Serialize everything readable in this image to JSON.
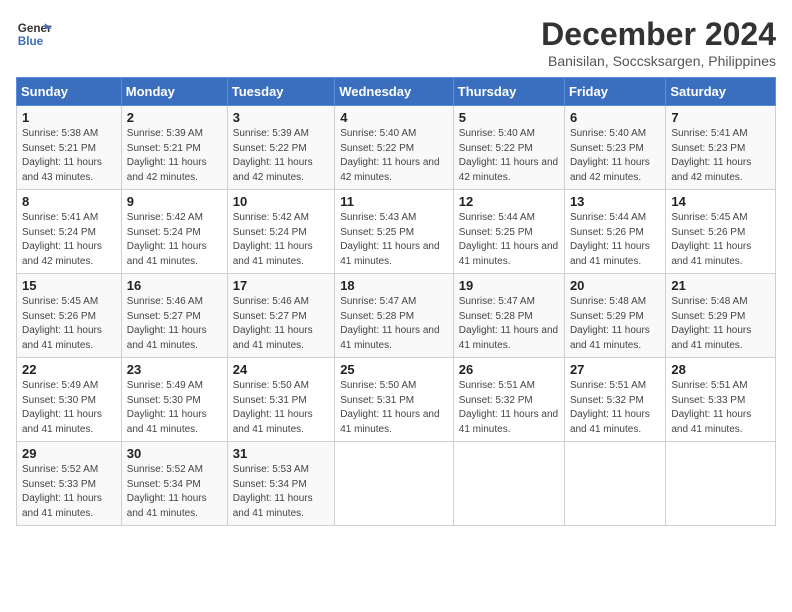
{
  "header": {
    "logo_line1": "General",
    "logo_line2": "Blue",
    "month": "December 2024",
    "location": "Banisilan, Soccsksargen, Philippines"
  },
  "days_of_week": [
    "Sunday",
    "Monday",
    "Tuesday",
    "Wednesday",
    "Thursday",
    "Friday",
    "Saturday"
  ],
  "weeks": [
    [
      {
        "day": 1,
        "sunrise": "5:38 AM",
        "sunset": "5:21 PM",
        "daylight": "11 hours and 43 minutes."
      },
      {
        "day": 2,
        "sunrise": "5:39 AM",
        "sunset": "5:21 PM",
        "daylight": "11 hours and 42 minutes."
      },
      {
        "day": 3,
        "sunrise": "5:39 AM",
        "sunset": "5:22 PM",
        "daylight": "11 hours and 42 minutes."
      },
      {
        "day": 4,
        "sunrise": "5:40 AM",
        "sunset": "5:22 PM",
        "daylight": "11 hours and 42 minutes."
      },
      {
        "day": 5,
        "sunrise": "5:40 AM",
        "sunset": "5:22 PM",
        "daylight": "11 hours and 42 minutes."
      },
      {
        "day": 6,
        "sunrise": "5:40 AM",
        "sunset": "5:23 PM",
        "daylight": "11 hours and 42 minutes."
      },
      {
        "day": 7,
        "sunrise": "5:41 AM",
        "sunset": "5:23 PM",
        "daylight": "11 hours and 42 minutes."
      }
    ],
    [
      {
        "day": 8,
        "sunrise": "5:41 AM",
        "sunset": "5:24 PM",
        "daylight": "11 hours and 42 minutes."
      },
      {
        "day": 9,
        "sunrise": "5:42 AM",
        "sunset": "5:24 PM",
        "daylight": "11 hours and 41 minutes."
      },
      {
        "day": 10,
        "sunrise": "5:42 AM",
        "sunset": "5:24 PM",
        "daylight": "11 hours and 41 minutes."
      },
      {
        "day": 11,
        "sunrise": "5:43 AM",
        "sunset": "5:25 PM",
        "daylight": "11 hours and 41 minutes."
      },
      {
        "day": 12,
        "sunrise": "5:44 AM",
        "sunset": "5:25 PM",
        "daylight": "11 hours and 41 minutes."
      },
      {
        "day": 13,
        "sunrise": "5:44 AM",
        "sunset": "5:26 PM",
        "daylight": "11 hours and 41 minutes."
      },
      {
        "day": 14,
        "sunrise": "5:45 AM",
        "sunset": "5:26 PM",
        "daylight": "11 hours and 41 minutes."
      }
    ],
    [
      {
        "day": 15,
        "sunrise": "5:45 AM",
        "sunset": "5:26 PM",
        "daylight": "11 hours and 41 minutes."
      },
      {
        "day": 16,
        "sunrise": "5:46 AM",
        "sunset": "5:27 PM",
        "daylight": "11 hours and 41 minutes."
      },
      {
        "day": 17,
        "sunrise": "5:46 AM",
        "sunset": "5:27 PM",
        "daylight": "11 hours and 41 minutes."
      },
      {
        "day": 18,
        "sunrise": "5:47 AM",
        "sunset": "5:28 PM",
        "daylight": "11 hours and 41 minutes."
      },
      {
        "day": 19,
        "sunrise": "5:47 AM",
        "sunset": "5:28 PM",
        "daylight": "11 hours and 41 minutes."
      },
      {
        "day": 20,
        "sunrise": "5:48 AM",
        "sunset": "5:29 PM",
        "daylight": "11 hours and 41 minutes."
      },
      {
        "day": 21,
        "sunrise": "5:48 AM",
        "sunset": "5:29 PM",
        "daylight": "11 hours and 41 minutes."
      }
    ],
    [
      {
        "day": 22,
        "sunrise": "5:49 AM",
        "sunset": "5:30 PM",
        "daylight": "11 hours and 41 minutes."
      },
      {
        "day": 23,
        "sunrise": "5:49 AM",
        "sunset": "5:30 PM",
        "daylight": "11 hours and 41 minutes."
      },
      {
        "day": 24,
        "sunrise": "5:50 AM",
        "sunset": "5:31 PM",
        "daylight": "11 hours and 41 minutes."
      },
      {
        "day": 25,
        "sunrise": "5:50 AM",
        "sunset": "5:31 PM",
        "daylight": "11 hours and 41 minutes."
      },
      {
        "day": 26,
        "sunrise": "5:51 AM",
        "sunset": "5:32 PM",
        "daylight": "11 hours and 41 minutes."
      },
      {
        "day": 27,
        "sunrise": "5:51 AM",
        "sunset": "5:32 PM",
        "daylight": "11 hours and 41 minutes."
      },
      {
        "day": 28,
        "sunrise": "5:51 AM",
        "sunset": "5:33 PM",
        "daylight": "11 hours and 41 minutes."
      }
    ],
    [
      {
        "day": 29,
        "sunrise": "5:52 AM",
        "sunset": "5:33 PM",
        "daylight": "11 hours and 41 minutes."
      },
      {
        "day": 30,
        "sunrise": "5:52 AM",
        "sunset": "5:34 PM",
        "daylight": "11 hours and 41 minutes."
      },
      {
        "day": 31,
        "sunrise": "5:53 AM",
        "sunset": "5:34 PM",
        "daylight": "11 hours and 41 minutes."
      },
      null,
      null,
      null,
      null
    ]
  ]
}
